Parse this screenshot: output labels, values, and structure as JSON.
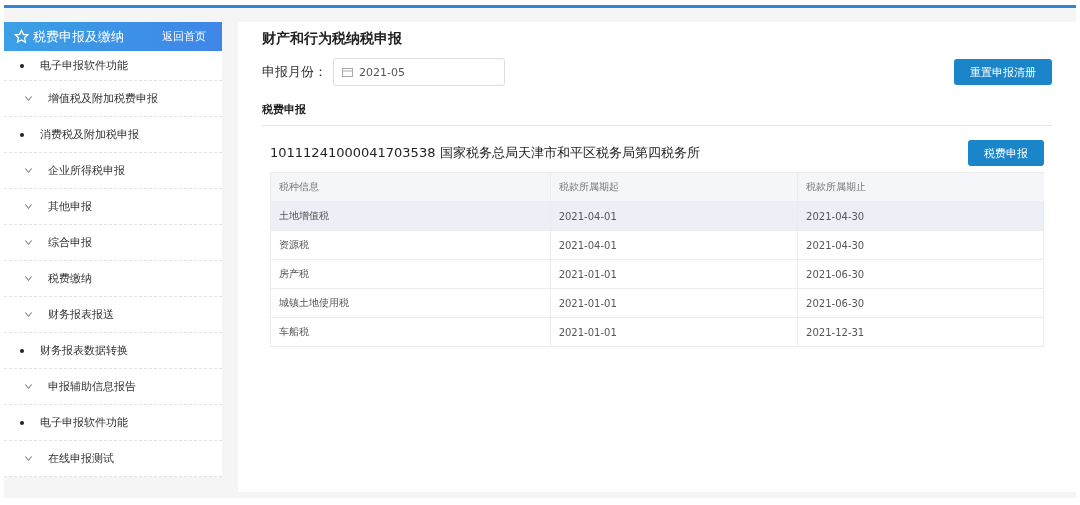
{
  "sidebar": {
    "header": {
      "title": "税费申报及缴纳",
      "link": "返回首页"
    },
    "items": [
      {
        "label": "电子申报软件功能",
        "kind": "bullet"
      },
      {
        "label": "增值税及附加税费申报",
        "kind": "expand"
      },
      {
        "label": "消费税及附加税申报",
        "kind": "bullet"
      },
      {
        "label": "企业所得税申报",
        "kind": "expand"
      },
      {
        "label": "其他申报",
        "kind": "expand"
      },
      {
        "label": "综合申报",
        "kind": "expand"
      },
      {
        "label": "税费缴纳",
        "kind": "expand"
      },
      {
        "label": "财务报表报送",
        "kind": "expand"
      },
      {
        "label": "财务报表数据转换",
        "kind": "bullet"
      },
      {
        "label": "申报辅助信息报告",
        "kind": "expand"
      },
      {
        "label": "电子申报软件功能",
        "kind": "bullet"
      },
      {
        "label": "在线申报测试",
        "kind": "expand"
      }
    ]
  },
  "main": {
    "title": "财产和行为税纳税申报",
    "month_label": "申报月份：",
    "month_value": "2021-05",
    "reset_button": "重置申报清册",
    "section_title": "税费申报",
    "org": "10111241000041703538 国家税务总局天津市和平区税务局第四税务所",
    "declare_button": "税费申报",
    "table": {
      "columns": [
        "税种信息",
        "税款所属期起",
        "税款所属期止"
      ],
      "rows": [
        {
          "cells": [
            "土地增值税",
            "2021-04-01",
            "2021-04-30"
          ],
          "selected": true
        },
        {
          "cells": [
            "资源税",
            "2021-04-01",
            "2021-04-30"
          ],
          "selected": false
        },
        {
          "cells": [
            "房产税",
            "2021-01-01",
            "2021-06-30"
          ],
          "selected": false
        },
        {
          "cells": [
            "城镇土地使用税",
            "2021-01-01",
            "2021-06-30"
          ],
          "selected": false
        },
        {
          "cells": [
            "车船税",
            "2021-01-01",
            "2021-12-31"
          ],
          "selected": false
        }
      ]
    }
  }
}
